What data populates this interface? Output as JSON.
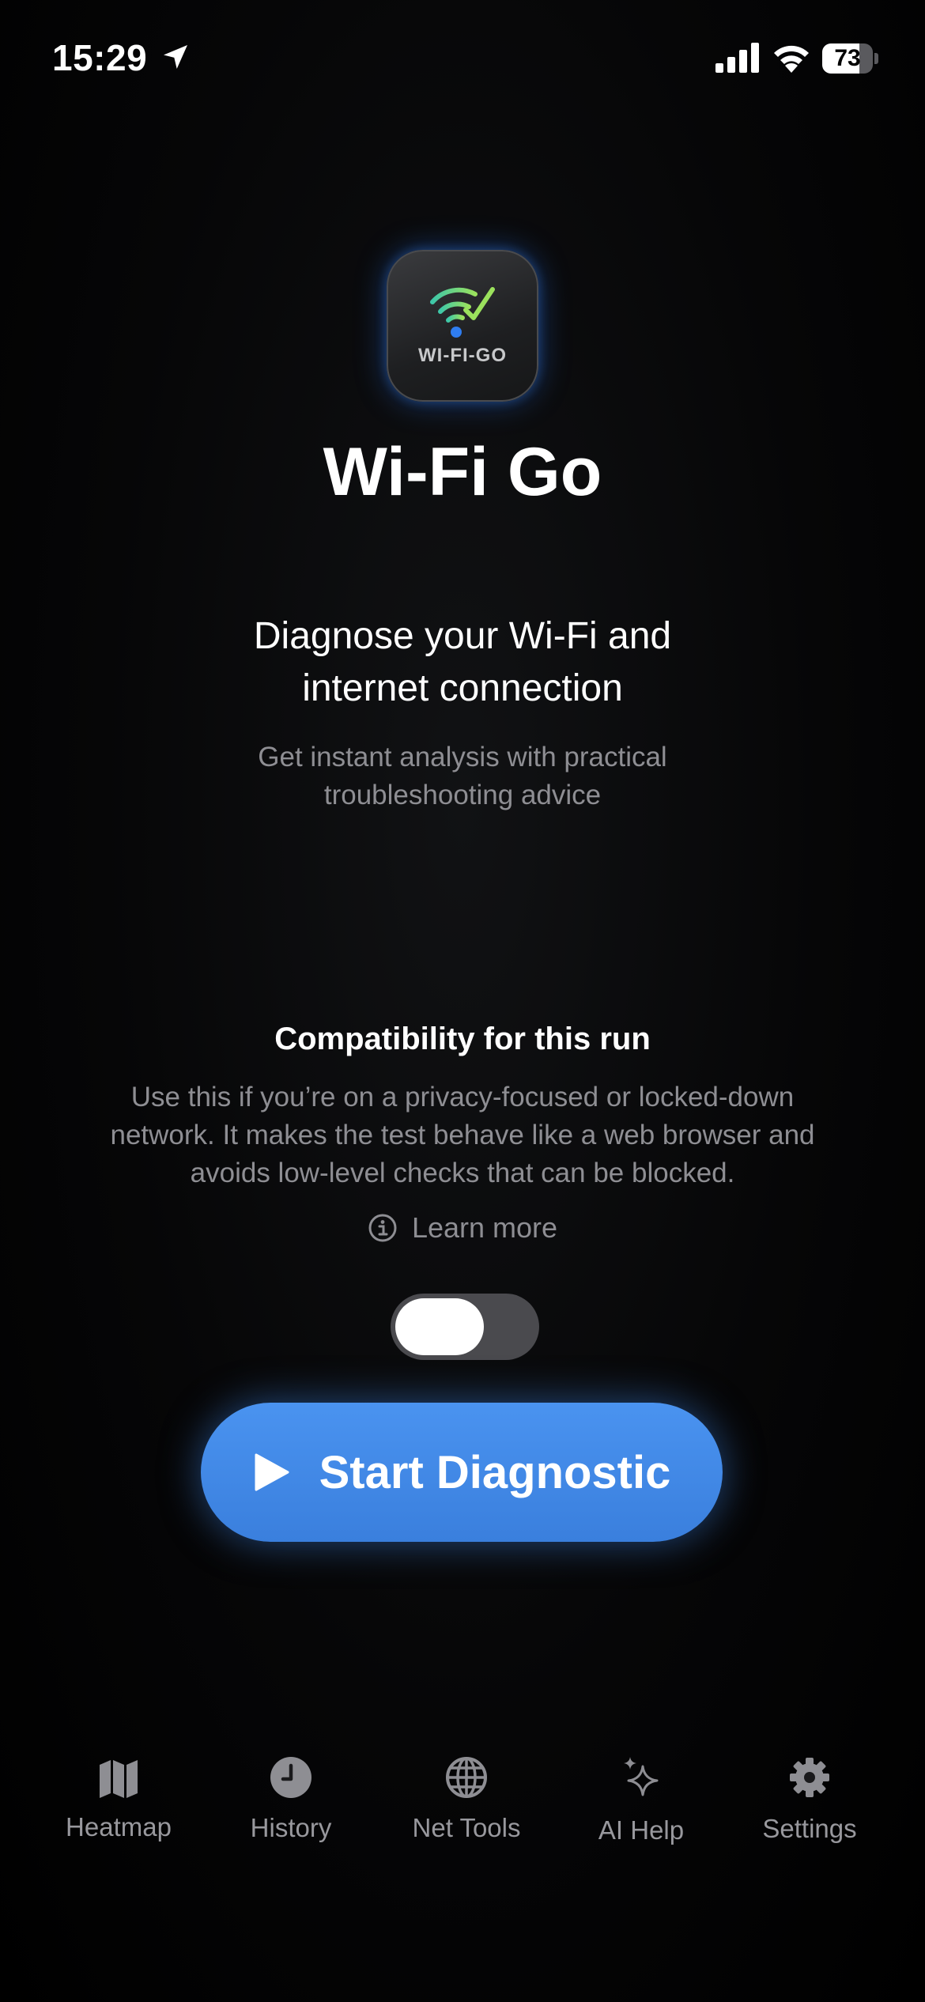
{
  "status_bar": {
    "time": "15:29",
    "battery": "73",
    "battery_fraction": 0.73,
    "icons": [
      "location-arrow-icon",
      "cellular-signal-icon",
      "wifi-icon",
      "battery-icon"
    ]
  },
  "app": {
    "icon_label": "WI-FI-GO",
    "title": "Wi-Fi Go"
  },
  "intro": {
    "headline_line1": "Diagnose your Wi-Fi and",
    "headline_line2": "internet connection",
    "sub_line1": "Get instant analysis with practical",
    "sub_line2": "troubleshooting advice"
  },
  "compatibility": {
    "title": "Compatibility for this run",
    "desc_line1": "Use this if you’re on a privacy-focused or locked-down",
    "desc_line2": "network. It makes the test behave like a web browser and",
    "desc_line3": "avoids low-level checks that can be blocked.",
    "learn_more": "Learn more",
    "toggle_on": false
  },
  "start_button": {
    "label": "Start Diagnostic"
  },
  "tab_bar": {
    "tabs": [
      {
        "label": "Heatmap",
        "icon": "map-icon"
      },
      {
        "label": "History",
        "icon": "clock-icon"
      },
      {
        "label": "Net Tools",
        "icon": "globe-icon"
      },
      {
        "label": "AI Help",
        "icon": "sparkles-icon"
      },
      {
        "label": "Settings",
        "icon": "gear-icon"
      }
    ]
  },
  "colors": {
    "accent": "#3a7fdd",
    "background": "#000000",
    "secondary_text": "#8e8e93"
  }
}
